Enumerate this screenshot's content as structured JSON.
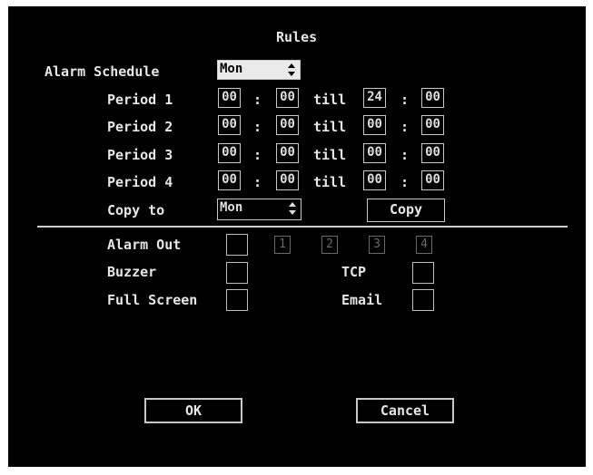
{
  "dialog": {
    "title": "Rules"
  },
  "schedule": {
    "label": "Alarm Schedule",
    "day": "Mon",
    "till_label": "till",
    "separator": ":",
    "periods": [
      {
        "label": "Period 1",
        "start_h": "00",
        "start_m": "00",
        "end_h": "24",
        "end_m": "00"
      },
      {
        "label": "Period 2",
        "start_h": "00",
        "start_m": "00",
        "end_h": "00",
        "end_m": "00"
      },
      {
        "label": "Period 3",
        "start_h": "00",
        "start_m": "00",
        "end_h": "00",
        "end_m": "00"
      },
      {
        "label": "Period 4",
        "start_h": "00",
        "start_m": "00",
        "end_h": "00",
        "end_m": "00"
      }
    ],
    "copy_to_label": "Copy to",
    "copy_to_day": "Mon",
    "copy_button": "Copy"
  },
  "actions": {
    "alarm_out_label": "Alarm Out",
    "outputs": [
      "1",
      "2",
      "3",
      "4"
    ],
    "buzzer_label": "Buzzer",
    "tcp_label": "TCP",
    "full_screen_label": "Full Screen",
    "email_label": "Email"
  },
  "buttons": {
    "ok": "OK",
    "cancel": "Cancel"
  },
  "icons": {
    "spinner": "up-down-arrows-icon"
  },
  "colors": {
    "background": "#000000",
    "text": "#e6e6e6",
    "border": "#c8c8c8",
    "selected_field": "#eaeaea"
  }
}
